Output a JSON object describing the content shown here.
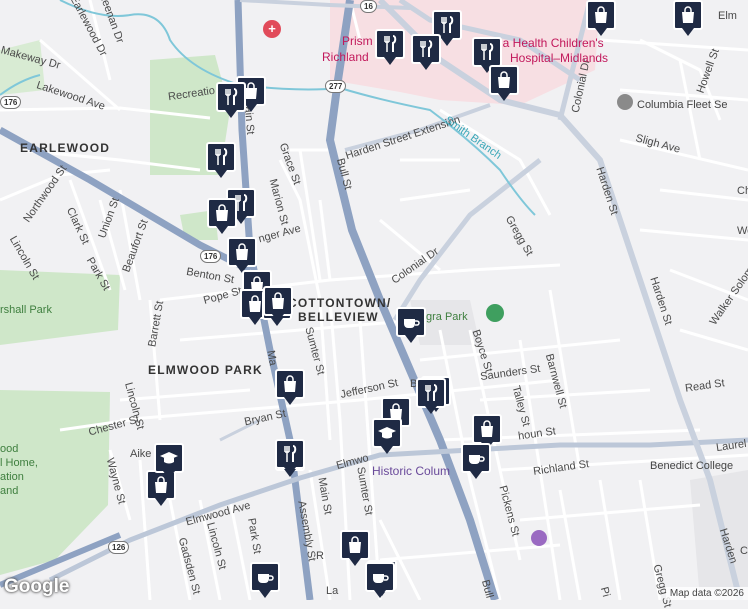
{
  "labels": {
    "neighborhoods": [
      "EARLEWOOD",
      "COTTONTOWN/",
      "BELLEVIEW",
      "ELMWOOD PARK"
    ],
    "streets": {
      "keenan": "Keenan Dr",
      "earlewood_dr": "Earlewood Dr",
      "makeway": "Makeway Dr",
      "lakewood": "Lakewood Ave",
      "recreation": "Recreatio",
      "northwood": "Northwood St",
      "clark": "Clark St",
      "union": "Union St",
      "beaufort": "Beaufort St",
      "lincoln_n": "Lincoln St",
      "park_n": "Park St",
      "barrett": "Barrett St",
      "grace": "Grace St",
      "marion_n": "Marion St",
      "main_n": "Main St",
      "bull": "Bull St",
      "harden_ext": "Harden Street Extension",
      "colonial_dr_e": "Colonial Dr",
      "colonial_dr": "Colonial Dr",
      "gregg": "Gregg St",
      "sligh": "Sligh Ave",
      "harden_st": "Harden St",
      "harden_st_s": "Harden St",
      "howell": "Howell St",
      "walker": "Walker Solomon Way",
      "benton": "Benton St",
      "pope": "Pope St",
      "anger": "nger Ave",
      "sumter_n": "Sumter St",
      "marion_s": "Ma",
      "jefferson": "Jefferson St",
      "bryan": "Bryan St",
      "boyce": "Boyce St",
      "saunders": "Saunders St",
      "barnwell": "Barnwell St",
      "talley": "Talley St",
      "read": "Read St",
      "calhoun": "houn St",
      "laurel": "Laurel",
      "richland": "Richland St",
      "pickens": "Pickens St",
      "chester": "Chester St",
      "lincoln_s": "Lincoln St",
      "aiken": "Aike",
      "wayne": "Wayne St",
      "elmwood": "Elmwood Ave",
      "elmwood_e": "Elmwo",
      "gadsden": "Gadsden St",
      "lincoln_sw": "Lincoln St",
      "park_s": "Park St",
      "assembly": "Assembly St",
      "main_s": "Main St",
      "sumter_s": "Sumter St",
      "bull_s": "Bull",
      "la": "La",
      "r": "R",
      "b_s": "B",
      "harden_se": "Harden",
      "gregg_s": "Gregg St",
      "pickens_s": "Pi",
      "elm": "Elm",
      "ch": "Ch",
      "we": "We",
      "c": "C"
    },
    "pois": {
      "prisma1": "Prism",
      "richland": "Richland",
      "prisma2": "isma Health Children's",
      "midlands": "Hospital–Midlands",
      "columbia_fleet": "Columbia Fleet Se",
      "smith_branch": "Smith Branch",
      "marshall_park": "rshall Park",
      "segra_park": "gra Park",
      "historic_columbia": "Historic Colum",
      "benedict": "Benedict College",
      "elmwood_home1": "ood",
      "elmwood_home2": "l Home,",
      "elmwood_home3": "ation",
      "elmwood_home4": "and"
    },
    "shields": [
      "16",
      "277",
      "176",
      "176",
      "126"
    ]
  },
  "markers": [
    {
      "icon": "shopping-bag-icon"
    },
    {
      "icon": "restaurant-icon"
    },
    {
      "icon": "restaurant-icon"
    },
    {
      "icon": "restaurant-icon"
    },
    {
      "icon": "restaurant-icon"
    },
    {
      "icon": "shopping-bag-icon"
    },
    {
      "icon": "restaurant-icon"
    },
    {
      "icon": "shopping-bag-icon"
    },
    {
      "icon": "restaurant-icon"
    },
    {
      "icon": "restaurant-icon"
    },
    {
      "icon": "shopping-bag-icon"
    },
    {
      "icon": "shopping-bag-icon"
    },
    {
      "icon": "shopping-bag-icon"
    },
    {
      "icon": "shopping-bag-icon"
    },
    {
      "icon": "restaurant-icon"
    },
    {
      "icon": "shopping-bag-icon"
    },
    {
      "icon": "shopping-bag-icon"
    },
    {
      "icon": "restaurant-icon"
    },
    {
      "icon": "coffee-icon"
    },
    {
      "icon": "restaurant-icon"
    },
    {
      "icon": "restaurant-icon"
    },
    {
      "icon": "shopping-bag-icon"
    },
    {
      "icon": "school-icon"
    },
    {
      "icon": "shopping-bag-icon"
    },
    {
      "icon": "coffee-icon"
    },
    {
      "icon": "restaurant-icon"
    },
    {
      "icon": "school-icon"
    },
    {
      "icon": "shopping-bag-icon"
    },
    {
      "icon": "coffee-icon"
    },
    {
      "icon": "shopping-cart-icon"
    },
    {
      "icon": "coffee-icon"
    },
    {
      "icon": "shopping-bag-icon"
    },
    {
      "icon": "shopping-bag-icon"
    }
  ],
  "branding": {
    "logo": "Google",
    "attribution": "Map data ©2026"
  },
  "zoom": {
    "plus": "+",
    "minus": "−"
  }
}
